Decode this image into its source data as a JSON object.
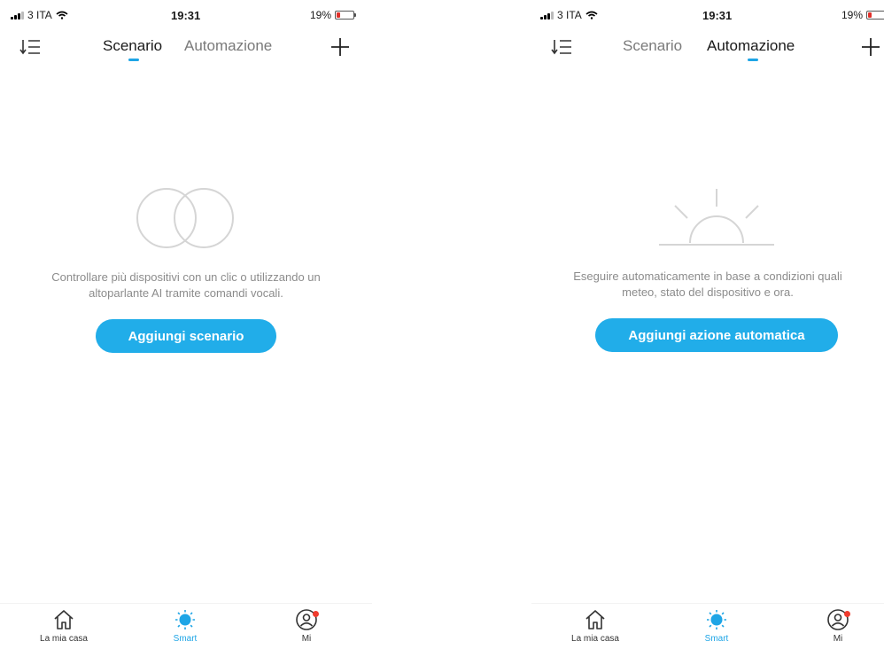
{
  "colors": {
    "accent": "#21ade9",
    "badge": "#f03c2e",
    "battery_low": "#e0302a"
  },
  "screens": [
    {
      "status": {
        "carrier": "3 ITA",
        "time": "19:31",
        "battery_text": "19%",
        "battery_level": 0.19
      },
      "nav": {
        "sort_icon": "sort-list-icon",
        "tabs": [
          "Scenario",
          "Automazione"
        ],
        "active_tab": "Scenario",
        "add_icon": "plus-icon"
      },
      "empty_state": {
        "icon": "overlapping-circles-icon",
        "line1": "Controllare più dispositivi con un clic o utilizzando un",
        "line2": "altoparlante AI tramite comandi vocali.",
        "button": "Aggiungi scenario"
      },
      "tabbar": [
        {
          "label": "La mia casa",
          "icon": "home-icon"
        },
        {
          "label": "Smart",
          "icon": "sun-icon",
          "active": true
        },
        {
          "label": "Mi",
          "icon": "user-icon",
          "badge": true
        }
      ]
    },
    {
      "status": {
        "carrier": "3 ITA",
        "time": "19:31",
        "battery_text": "19%",
        "battery_level": 0.19
      },
      "nav": {
        "sort_icon": "sort-list-icon",
        "tabs": [
          "Scenario",
          "Automazione"
        ],
        "active_tab": "Automazione",
        "add_icon": "plus-icon"
      },
      "empty_state": {
        "icon": "sunrise-icon",
        "line1": "Eseguire automaticamente in base a condizioni quali",
        "line2": "meteo, stato del dispositivo e ora.",
        "button": "Aggiungi azione automatica"
      },
      "tabbar": [
        {
          "label": "La mia casa",
          "icon": "home-icon"
        },
        {
          "label": "Smart",
          "icon": "sun-icon",
          "active": true
        },
        {
          "label": "Mi",
          "icon": "user-icon",
          "badge": true
        }
      ]
    }
  ]
}
